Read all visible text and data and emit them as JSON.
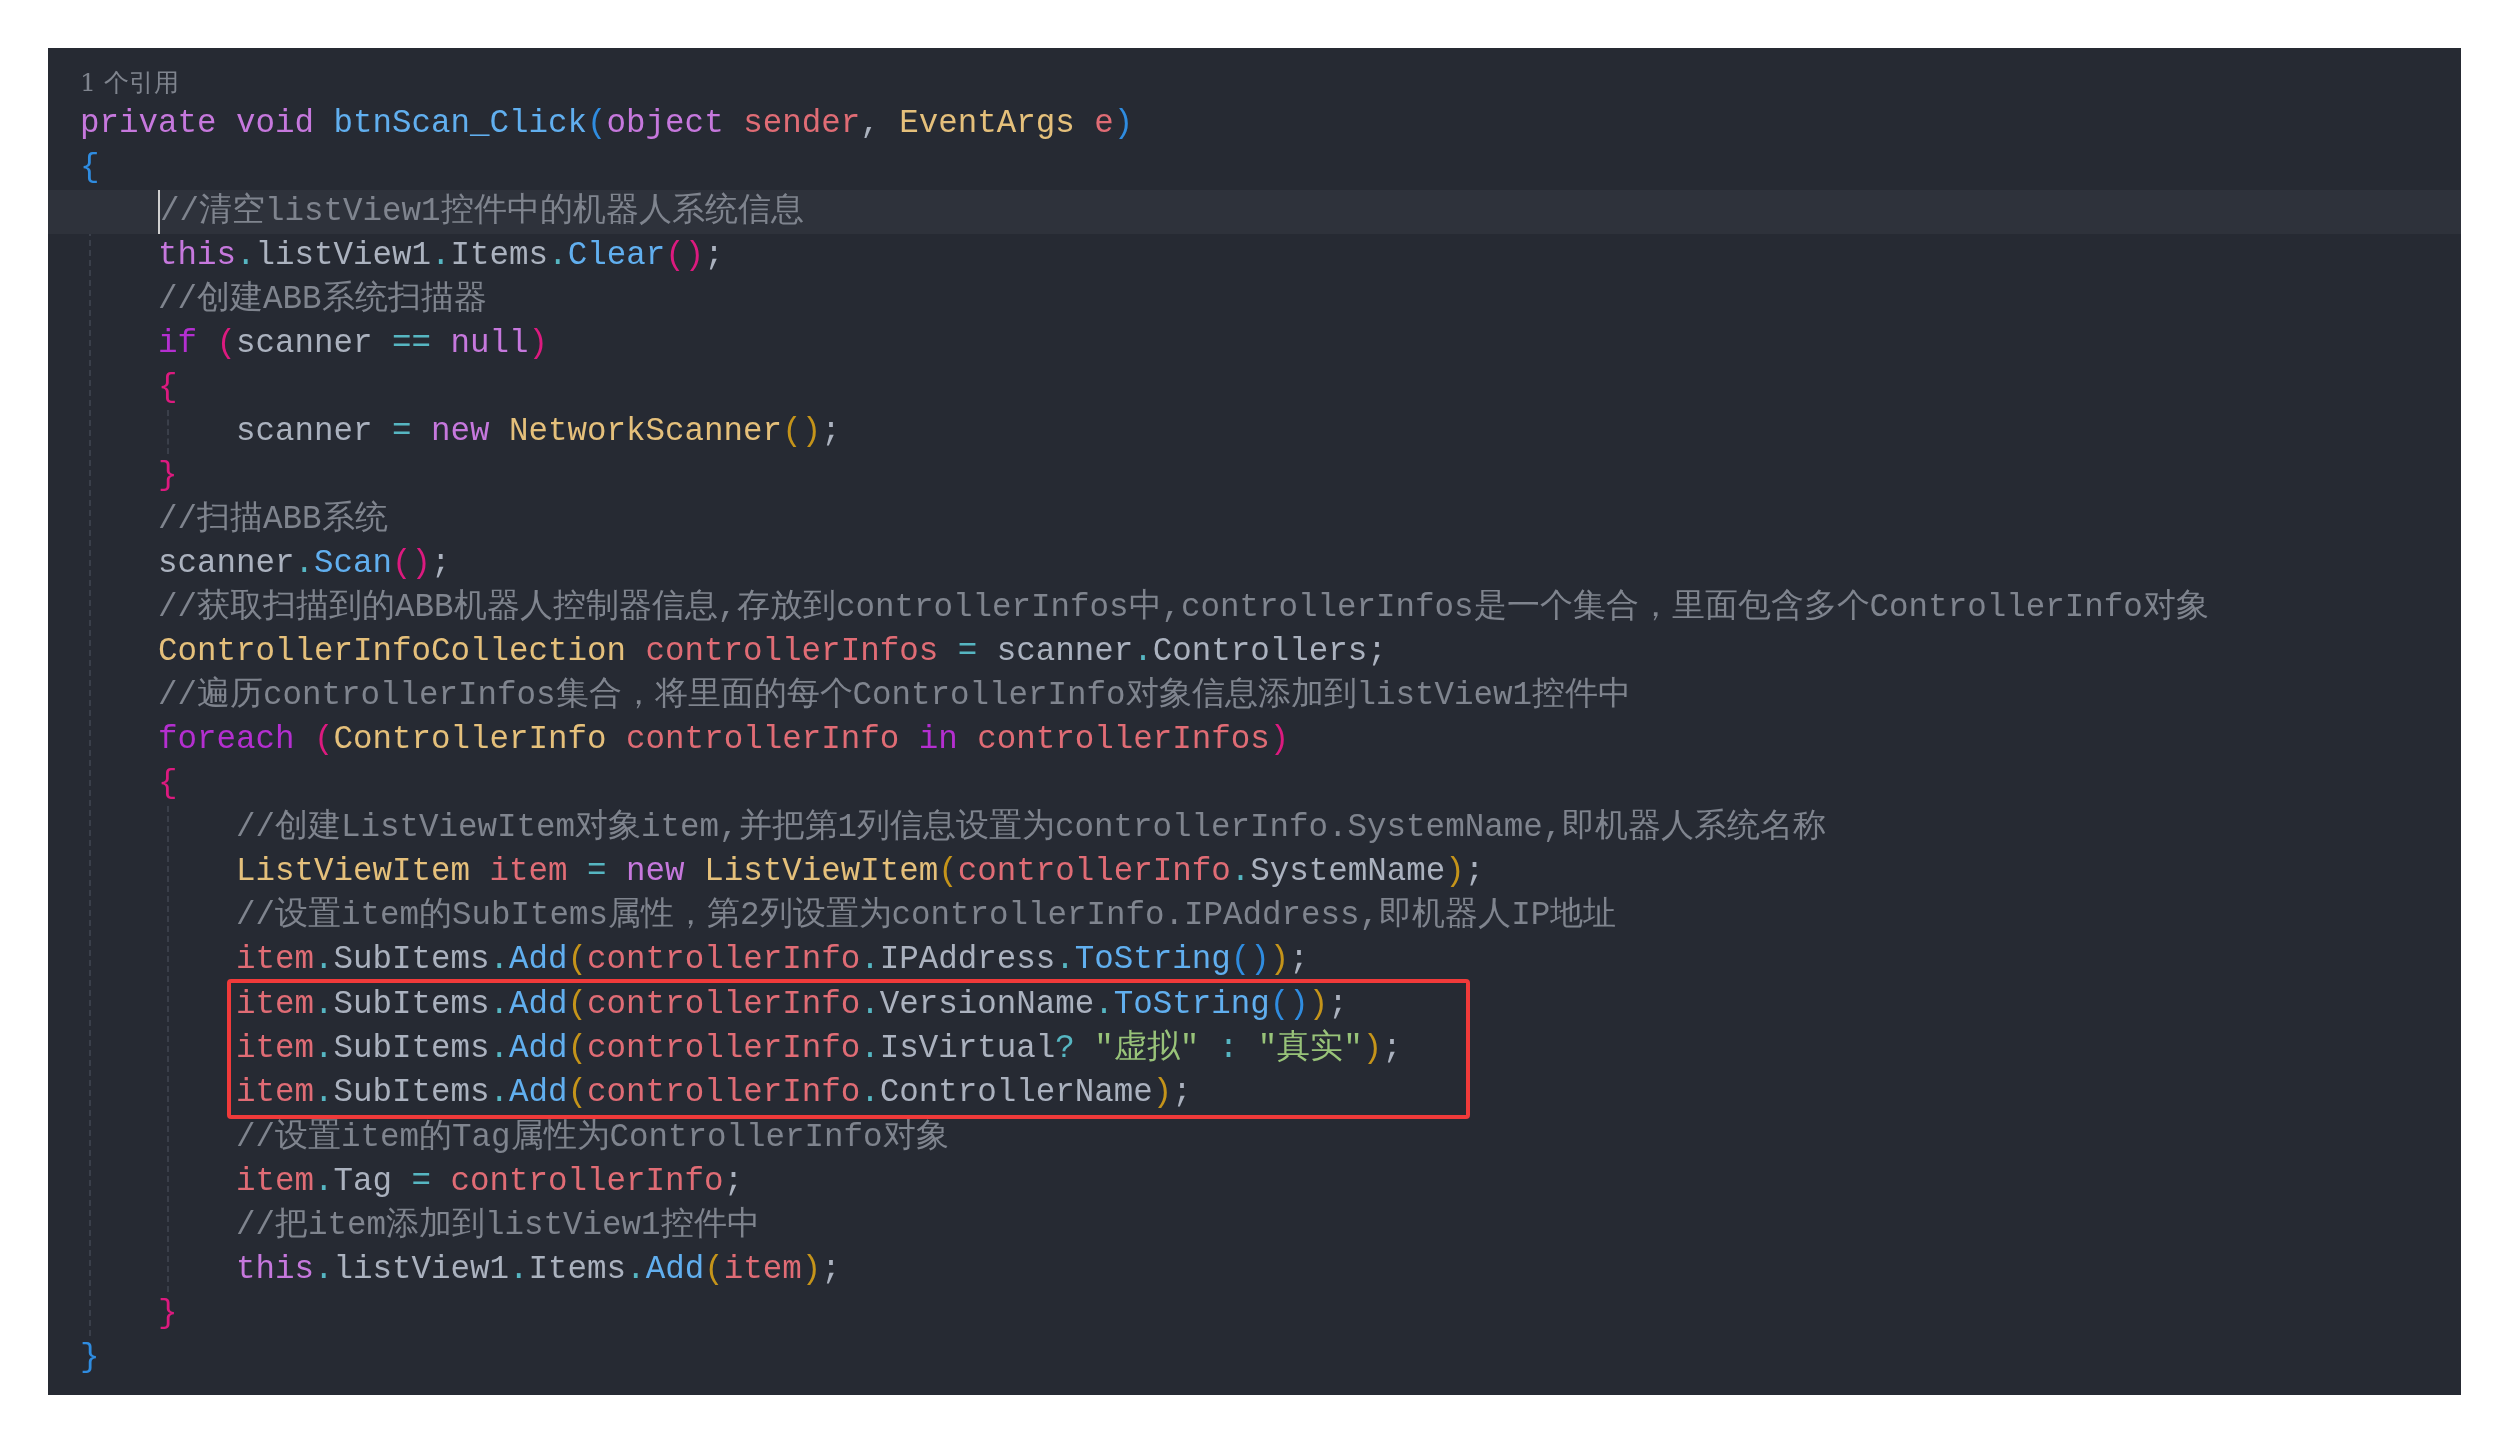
{
  "codelens": "1 个引用",
  "lines": [
    {
      "tokens": [
        {
          "kind": "kw",
          "text": "private void "
        },
        {
          "kind": "method",
          "text": "btnScan_Click"
        },
        {
          "kind": "b1",
          "text": "("
        },
        {
          "kind": "kw",
          "text": "object "
        },
        {
          "kind": "var",
          "text": "sender"
        },
        {
          "kind": "plain",
          "text": ", "
        },
        {
          "kind": "type",
          "text": "EventArgs "
        },
        {
          "kind": "var",
          "text": "e"
        },
        {
          "kind": "b1",
          "text": ")"
        }
      ]
    },
    {
      "tokens": [
        {
          "kind": "b1",
          "text": "{"
        }
      ],
      "children": [
        {
          "current": true,
          "tokens": [
            {
              "kind": "comment",
              "text": "//清空listView1控件中的机器人系统信息"
            }
          ]
        },
        {
          "tokens": [
            {
              "kind": "this",
              "text": "this"
            },
            {
              "kind": "op",
              "text": "."
            },
            {
              "kind": "plain",
              "text": "listView1"
            },
            {
              "kind": "op",
              "text": "."
            },
            {
              "kind": "plain",
              "text": "Items"
            },
            {
              "kind": "op",
              "text": "."
            },
            {
              "kind": "method",
              "text": "Clear"
            },
            {
              "kind": "b2",
              "text": "()"
            },
            {
              "kind": "plain",
              "text": ";"
            }
          ]
        },
        {
          "tokens": [
            {
              "kind": "comment",
              "text": "//创建ABB系统扫描器"
            }
          ]
        },
        {
          "tokens": [
            {
              "kind": "ctrl",
              "text": "if "
            },
            {
              "kind": "b2",
              "text": "("
            },
            {
              "kind": "plain",
              "text": "scanner "
            },
            {
              "kind": "op",
              "text": "=="
            },
            {
              "kind": "kw",
              "text": " null"
            },
            {
              "kind": "b2",
              "text": ")"
            }
          ]
        },
        {
          "tokens": [
            {
              "kind": "b2",
              "text": "{"
            }
          ],
          "children": [
            {
              "tokens": [
                {
                  "kind": "plain",
                  "text": "scanner "
                },
                {
                  "kind": "op",
                  "text": "="
                },
                {
                  "kind": "kw",
                  "text": " new "
                },
                {
                  "kind": "type",
                  "text": "NetworkScanner"
                },
                {
                  "kind": "b3",
                  "text": "()"
                },
                {
                  "kind": "plain",
                  "text": ";"
                }
              ]
            }
          ]
        },
        {
          "tokens": [
            {
              "kind": "b2",
              "text": "}"
            }
          ]
        },
        {
          "tokens": [
            {
              "kind": "comment",
              "text": "//扫描ABB系统"
            }
          ]
        },
        {
          "tokens": [
            {
              "kind": "plain",
              "text": "scanner"
            },
            {
              "kind": "op",
              "text": "."
            },
            {
              "kind": "method",
              "text": "Scan"
            },
            {
              "kind": "b2",
              "text": "()"
            },
            {
              "kind": "plain",
              "text": ";"
            }
          ]
        },
        {
          "tokens": [
            {
              "kind": "comment",
              "text": "//获取扫描到的ABB机器人控制器信息,存放到controllerInfos中,controllerInfos是一个集合，里面包含多个ControllerInfo对象"
            }
          ]
        },
        {
          "tokens": [
            {
              "kind": "type",
              "text": "ControllerInfoCollection "
            },
            {
              "kind": "var",
              "text": "controllerInfos "
            },
            {
              "kind": "op",
              "text": "="
            },
            {
              "kind": "plain",
              "text": " scanner"
            },
            {
              "kind": "op",
              "text": "."
            },
            {
              "kind": "plain",
              "text": "Controllers;"
            }
          ]
        },
        {
          "tokens": [
            {
              "kind": "comment",
              "text": "//遍历controllerInfos集合，将里面的每个ControllerInfo对象信息添加到listView1控件中"
            }
          ]
        },
        {
          "tokens": [
            {
              "kind": "ctrl",
              "text": "foreach "
            },
            {
              "kind": "b2",
              "text": "("
            },
            {
              "kind": "type",
              "text": "ControllerInfo "
            },
            {
              "kind": "var",
              "text": "controllerInfo "
            },
            {
              "kind": "ctrl",
              "text": "in "
            },
            {
              "kind": "var",
              "text": "controllerInfos"
            },
            {
              "kind": "b2",
              "text": ")"
            }
          ]
        },
        {
          "tokens": [
            {
              "kind": "b2",
              "text": "{"
            }
          ],
          "children": [
            {
              "tokens": [
                {
                  "kind": "comment",
                  "text": "//创建ListViewItem对象item,并把第1列信息设置为controllerInfo.SystemName,即机器人系统名称"
                }
              ]
            },
            {
              "tokens": [
                {
                  "kind": "type",
                  "text": "ListViewItem "
                },
                {
                  "kind": "var",
                  "text": "item "
                },
                {
                  "kind": "op",
                  "text": "="
                },
                {
                  "kind": "kw",
                  "text": " new "
                },
                {
                  "kind": "type",
                  "text": "ListViewItem"
                },
                {
                  "kind": "b3",
                  "text": "("
                },
                {
                  "kind": "var",
                  "text": "controllerInfo"
                },
                {
                  "kind": "op",
                  "text": "."
                },
                {
                  "kind": "plain",
                  "text": "SystemName"
                },
                {
                  "kind": "b3",
                  "text": ")"
                },
                {
                  "kind": "plain",
                  "text": ";"
                }
              ]
            },
            {
              "tokens": [
                {
                  "kind": "comment",
                  "text": "//设置item的SubItems属性，第2列设置为controllerInfo.IPAddress,即机器人IP地址"
                }
              ]
            },
            {
              "tokens": [
                {
                  "kind": "var",
                  "text": "item"
                },
                {
                  "kind": "op",
                  "text": "."
                },
                {
                  "kind": "plain",
                  "text": "SubItems"
                },
                {
                  "kind": "op",
                  "text": "."
                },
                {
                  "kind": "method",
                  "text": "Add"
                },
                {
                  "kind": "b3",
                  "text": "("
                },
                {
                  "kind": "var",
                  "text": "controllerInfo"
                },
                {
                  "kind": "op",
                  "text": "."
                },
                {
                  "kind": "plain",
                  "text": "IPAddress"
                },
                {
                  "kind": "op",
                  "text": "."
                },
                {
                  "kind": "method",
                  "text": "ToString"
                },
                {
                  "kind": "b1",
                  "text": "()"
                },
                {
                  "kind": "b3",
                  "text": ")"
                },
                {
                  "kind": "plain",
                  "text": ";"
                }
              ]
            },
            {
              "highlighted": true,
              "tokens": [
                {
                  "kind": "var",
                  "text": "item"
                },
                {
                  "kind": "op",
                  "text": "."
                },
                {
                  "kind": "plain",
                  "text": "SubItems"
                },
                {
                  "kind": "op",
                  "text": "."
                },
                {
                  "kind": "method",
                  "text": "Add"
                },
                {
                  "kind": "b3",
                  "text": "("
                },
                {
                  "kind": "var",
                  "text": "controllerInfo"
                },
                {
                  "kind": "op",
                  "text": "."
                },
                {
                  "kind": "plain",
                  "text": "VersionName"
                },
                {
                  "kind": "op",
                  "text": "."
                },
                {
                  "kind": "method",
                  "text": "ToString"
                },
                {
                  "kind": "b1",
                  "text": "()"
                },
                {
                  "kind": "b3",
                  "text": ")"
                },
                {
                  "kind": "plain",
                  "text": ";"
                }
              ]
            },
            {
              "highlighted": true,
              "tokens": [
                {
                  "kind": "var",
                  "text": "item"
                },
                {
                  "kind": "op",
                  "text": "."
                },
                {
                  "kind": "plain",
                  "text": "SubItems"
                },
                {
                  "kind": "op",
                  "text": "."
                },
                {
                  "kind": "method",
                  "text": "Add"
                },
                {
                  "kind": "b3",
                  "text": "("
                },
                {
                  "kind": "var",
                  "text": "controllerInfo"
                },
                {
                  "kind": "op",
                  "text": "."
                },
                {
                  "kind": "plain",
                  "text": "IsVirtual"
                },
                {
                  "kind": "op",
                  "text": "? "
                },
                {
                  "kind": "str",
                  "text": "\"虚拟\""
                },
                {
                  "kind": "op",
                  "text": " : "
                },
                {
                  "kind": "str",
                  "text": "\"真实\""
                },
                {
                  "kind": "b3",
                  "text": ")"
                },
                {
                  "kind": "plain",
                  "text": ";"
                }
              ]
            },
            {
              "highlighted": true,
              "tokens": [
                {
                  "kind": "var",
                  "text": "item"
                },
                {
                  "kind": "op",
                  "text": "."
                },
                {
                  "kind": "plain",
                  "text": "SubItems"
                },
                {
                  "kind": "op",
                  "text": "."
                },
                {
                  "kind": "method",
                  "text": "Add"
                },
                {
                  "kind": "b3",
                  "text": "("
                },
                {
                  "kind": "var",
                  "text": "controllerInfo"
                },
                {
                  "kind": "op",
                  "text": "."
                },
                {
                  "kind": "plain",
                  "text": "ControllerName"
                },
                {
                  "kind": "b3",
                  "text": ")"
                },
                {
                  "kind": "plain",
                  "text": ";"
                }
              ]
            },
            {
              "tokens": [
                {
                  "kind": "comment",
                  "text": "//设置item的Tag属性为ControllerInfo对象"
                }
              ]
            },
            {
              "tokens": [
                {
                  "kind": "var",
                  "text": "item"
                },
                {
                  "kind": "op",
                  "text": "."
                },
                {
                  "kind": "plain",
                  "text": "Tag "
                },
                {
                  "kind": "op",
                  "text": "="
                },
                {
                  "kind": "var",
                  "text": " controllerInfo"
                },
                {
                  "kind": "plain",
                  "text": ";"
                }
              ]
            },
            {
              "tokens": [
                {
                  "kind": "comment",
                  "text": "//把item添加到listView1控件中"
                }
              ]
            },
            {
              "tokens": [
                {
                  "kind": "this",
                  "text": "this"
                },
                {
                  "kind": "op",
                  "text": "."
                },
                {
                  "kind": "plain",
                  "text": "listView1"
                },
                {
                  "kind": "op",
                  "text": "."
                },
                {
                  "kind": "plain",
                  "text": "Items"
                },
                {
                  "kind": "op",
                  "text": "."
                },
                {
                  "kind": "method",
                  "text": "Add"
                },
                {
                  "kind": "b3",
                  "text": "("
                },
                {
                  "kind": "var",
                  "text": "item"
                },
                {
                  "kind": "b3",
                  "text": ")"
                },
                {
                  "kind": "plain",
                  "text": ";"
                }
              ]
            }
          ]
        },
        {
          "tokens": [
            {
              "kind": "b2",
              "text": "}"
            }
          ]
        }
      ]
    },
    {
      "tokens": [
        {
          "kind": "b1",
          "text": "}"
        }
      ]
    }
  ]
}
